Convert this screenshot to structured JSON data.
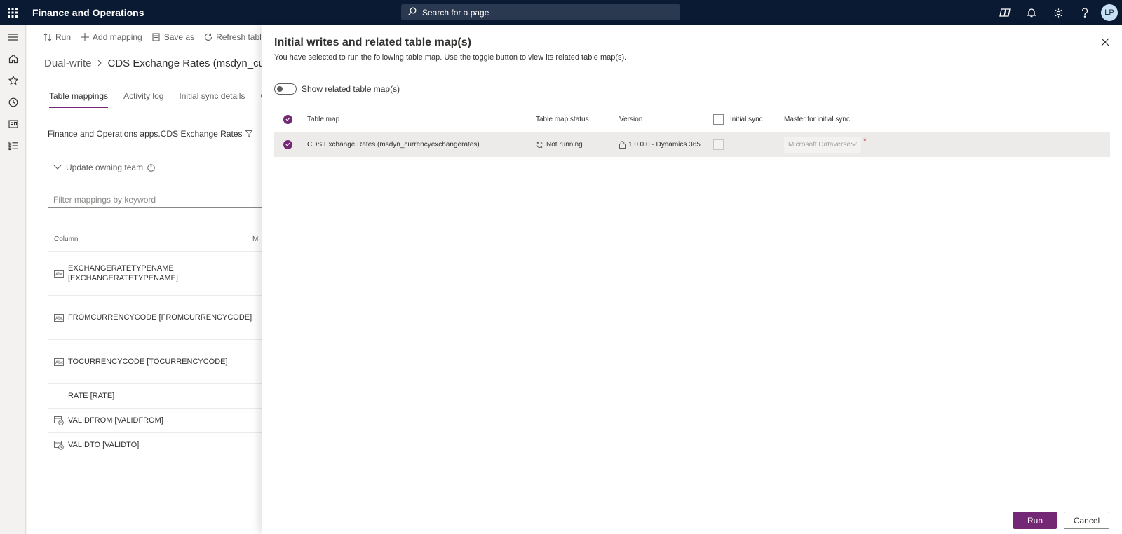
{
  "topbar": {
    "app_title": "Finance and Operations",
    "search_placeholder": "Search for a page",
    "avatar_initials": "LP"
  },
  "actionbar": {
    "run": "Run",
    "add_mapping": "Add mapping",
    "save_as": "Save as",
    "refresh_tables": "Refresh tables"
  },
  "breadcrumb": {
    "root": "Dual-write",
    "current": "CDS Exchange Rates (msdyn_currer"
  },
  "tabs": [
    "Table mappings",
    "Activity log",
    "Initial sync details",
    "Qu"
  ],
  "entity_title": "Finance and Operations apps.CDS Exchange Rates",
  "update_owning_team": "Update owning team",
  "filter_placeholder": "Filter mappings by keyword",
  "mapping_table": {
    "column_header": "Column",
    "column_header_2": "M",
    "rows": [
      "EXCHANGERATETYPENAME [EXCHANGERATETYPENAME]",
      "FROMCURRENCYCODE [FROMCURRENCYCODE]",
      "TOCURRENCYCODE [TOCURRENCYCODE]",
      "RATE [RATE]",
      "VALIDFROM [VALIDFROM]",
      "VALIDTO [VALIDTO]"
    ]
  },
  "dialog": {
    "title": "Initial writes and related table map(s)",
    "subtitle": "You have selected to run the following table map. Use the toggle button to view its related table map(s).",
    "toggle_label": "Show related table map(s)",
    "headers": {
      "table_map": "Table map",
      "status": "Table map status",
      "version": "Version",
      "initial_sync": "Initial sync",
      "master": "Master for initial sync"
    },
    "row": {
      "table_map": "CDS Exchange Rates (msdyn_currencyexchangerates)",
      "status": "Not running",
      "version": "1.0.0.0 - Dynamics 365",
      "master": "Microsoft Dataverse",
      "required_mark": "*"
    },
    "run_button": "Run",
    "cancel_button": "Cancel"
  },
  "colors": {
    "topbar": "#0b1a33",
    "accent": "#742774"
  }
}
